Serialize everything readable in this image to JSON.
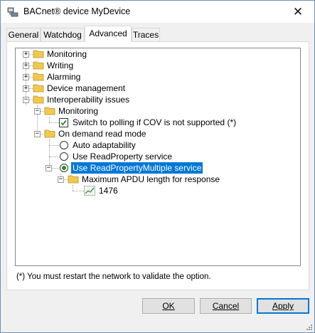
{
  "window": {
    "title": "BACnet® device MyDevice",
    "close_glyph": "✕"
  },
  "tabs": [
    {
      "label": "General"
    },
    {
      "label": "Watchdog"
    },
    {
      "label": "Advanced",
      "active": true
    },
    {
      "label": "Traces"
    }
  ],
  "tree": {
    "monitoring": "Monitoring",
    "writing": "Writing",
    "alarming": "Alarming",
    "device_management": "Device management",
    "interop": "Interoperability issues",
    "interop_monitoring": "Monitoring",
    "switch_polling": "Switch to polling if COV is not supported (*)",
    "switch_polling_checked": true,
    "on_demand": "On demand read mode",
    "auto_adapt": "Auto adaptability",
    "use_rp": "Use ReadProperty service",
    "use_rpm": "Use ReadPropertyMultiple service",
    "selected_option": "Use ReadPropertyMultiple service",
    "max_apdu": "Maximum APDU length for response",
    "apdu_value": "1476",
    "expand_collapsed": "+",
    "expand_expanded": "−"
  },
  "note": "(*) You must restart the network to validate the option.",
  "buttons": {
    "ok": "OK",
    "cancel": "Cancel",
    "apply": "Apply"
  },
  "colors": {
    "selection": "#0078d7",
    "folder": "#f2c94c",
    "check": "#2c8a2c"
  }
}
